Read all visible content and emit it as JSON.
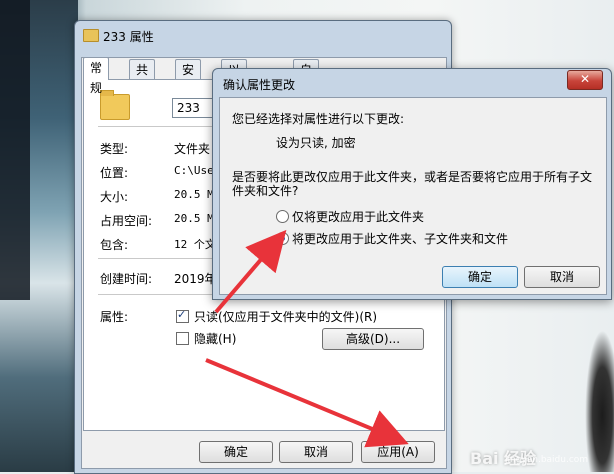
{
  "background": {
    "watermark": "Bai 经验",
    "watermark_sub": "jingyan.baidu.com"
  },
  "properties_window": {
    "title": "233 属性",
    "close_label": "✕",
    "tabs": [
      "常规",
      "共享",
      "安全",
      "以前的版本",
      "自定义"
    ],
    "folder_name": "233",
    "rows": [
      {
        "label": "类型:",
        "value": "文件夹"
      },
      {
        "label": "位置:",
        "value": "C:\\User"
      },
      {
        "label": "大小:",
        "value": "20.5 MB"
      },
      {
        "label": "占用空间:",
        "value": "20.5 MB"
      },
      {
        "label": "包含:",
        "value": "12 个文"
      },
      {
        "label": "创建时间:",
        "value": "2019年5"
      }
    ],
    "attributes_label": "属性:",
    "readonly_label": "只读(仅应用于文件夹中的文件)(R)",
    "readonly_checked": true,
    "hidden_label": "隐藏(H)",
    "hidden_checked": false,
    "advanced_button": "高级(D)...",
    "ok_button": "确定",
    "cancel_button": "取消",
    "apply_button": "应用(A)"
  },
  "confirm_dialog": {
    "title": "确认属性更改",
    "close_label": "✕",
    "message": "您已经选择对属性进行以下更改:",
    "changes": "设为只读, 加密",
    "question_line1": "是否要将此更改仅应用于此文件夹，或者是否要将它应用于所有子文",
    "question_line2": "件夹和文件?",
    "option1": "仅将更改应用于此文件夹",
    "option2": "将更改应用于此文件夹、子文件夹和文件",
    "selected_option": 2,
    "ok_button": "确定",
    "cancel_button": "取消"
  },
  "colors": {
    "annotation_arrow": "#e8333a",
    "titlebar": "#c6d5e5"
  }
}
